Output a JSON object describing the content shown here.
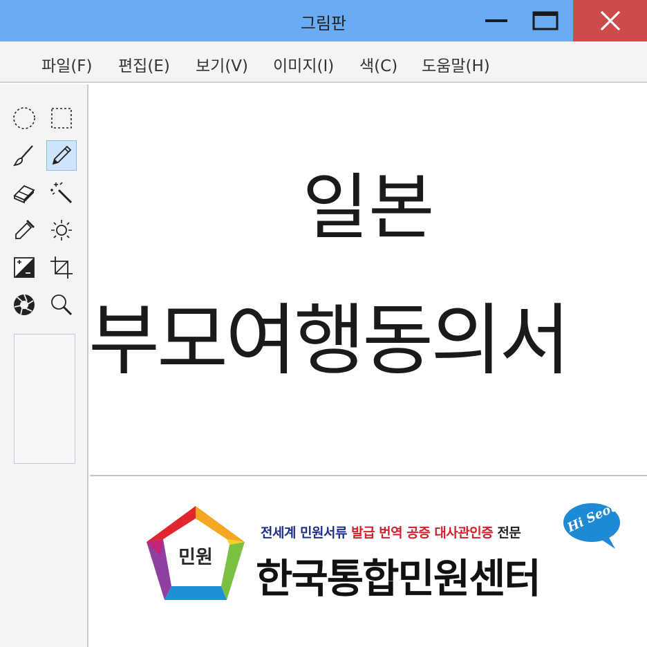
{
  "window": {
    "title": "그림판",
    "icons": {
      "minimize": "minimize-icon",
      "maximize": "maximize-icon",
      "close": "close-icon"
    },
    "colors": {
      "titlebar": "#6aabf6",
      "close": "#cc4b4b"
    }
  },
  "menu": {
    "items": [
      "파일(F)",
      "편집(E)",
      "보기(V)",
      "이미지(I)",
      "색(C)",
      "도움말(H)"
    ]
  },
  "tools": [
    {
      "name": "ellipse-select-icon",
      "selected": false
    },
    {
      "name": "rect-select-icon",
      "selected": false
    },
    {
      "name": "brush-icon",
      "selected": false
    },
    {
      "name": "pencil-icon",
      "selected": true
    },
    {
      "name": "eraser-icon",
      "selected": false
    },
    {
      "name": "magic-wand-icon",
      "selected": false
    },
    {
      "name": "eyedropper-icon",
      "selected": false
    },
    {
      "name": "brightness-icon",
      "selected": false
    },
    {
      "name": "contrast-icon",
      "selected": false
    },
    {
      "name": "crop-icon",
      "selected": false
    },
    {
      "name": "aperture-icon",
      "selected": false
    },
    {
      "name": "zoom-icon",
      "selected": false
    }
  ],
  "canvas": {
    "line1": "일본",
    "line2": "부모여행동의서"
  },
  "banner": {
    "logo_text": "민원",
    "tagline": {
      "part1": "전세계 민원서류 ",
      "part2": "발급 번역 공증 대사관인증",
      "part3": " 전문"
    },
    "name": "한국통합민원센터",
    "badge": "Hi Seoul",
    "colors": {
      "blue": "#1e2f8a",
      "red": "#d31e2b"
    }
  }
}
